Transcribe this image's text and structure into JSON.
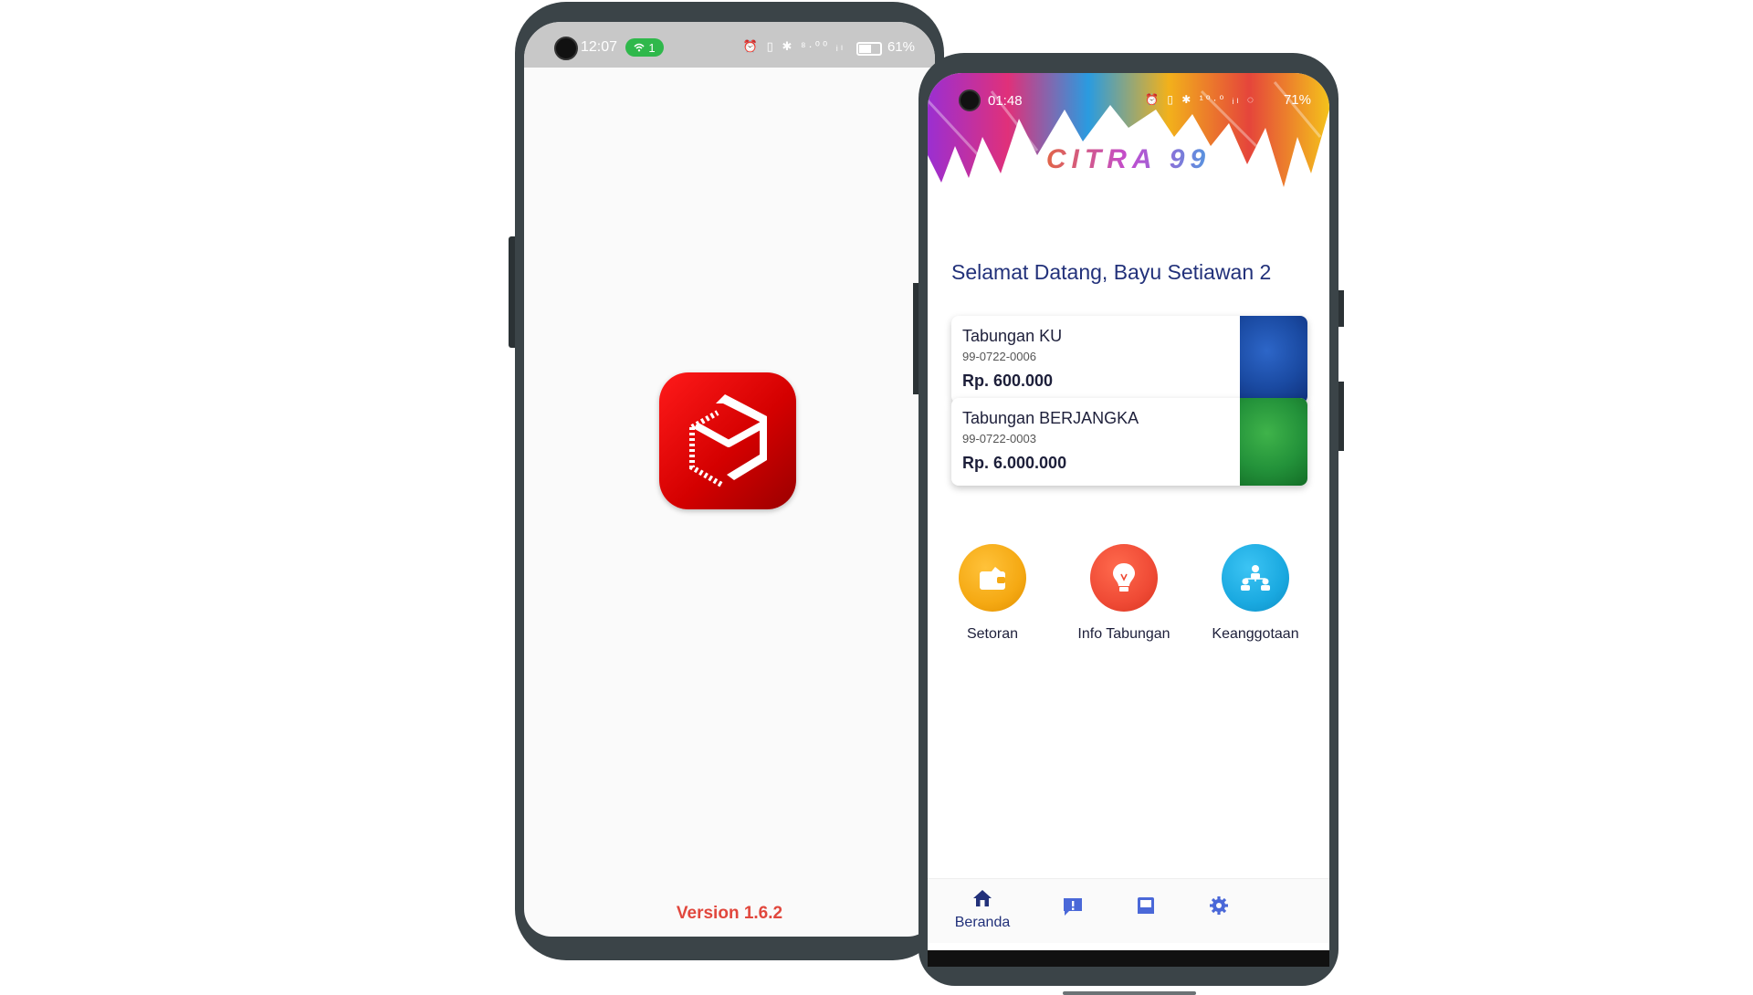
{
  "splash": {
    "status_bar": {
      "time": "12:07",
      "hotspot_count": "1",
      "icons": "⏰ ▯ ✱ ⁸·⁰⁰ ᵢₗ",
      "battery_pct": "61%"
    },
    "version": "Version 1.6.2",
    "logo_color": "#e00000"
  },
  "home": {
    "status_bar": {
      "time": "01:48",
      "icons": "⏰ ▯ ✱ ¹⁰·⁰ ᵢₗ ◌",
      "battery_pct": "71%"
    },
    "brand": "CITRA 99",
    "welcome": "Selamat Datang, Bayu Setiawan 2",
    "accounts": [
      {
        "name": "Tabungan KU",
        "number": "99-0722-0006",
        "balance": "Rp. 600.000",
        "color": "#1a4aa2"
      },
      {
        "name": "Tabungan BERJANGKA",
        "number": "99-0722-0003",
        "balance": "Rp. 6.000.000",
        "color": "#23923a"
      }
    ],
    "menu": [
      {
        "label": "Setoran",
        "icon": "wallet-icon",
        "color": "#f5a913"
      },
      {
        "label": "Info Tabungan",
        "icon": "lightbulb-icon",
        "color": "#ef4a35"
      },
      {
        "label": "Keanggotaan",
        "icon": "members-icon",
        "color": "#1aa9e0"
      }
    ],
    "bottom_nav": [
      {
        "label": "Beranda",
        "icon": "home-icon"
      },
      {
        "label": "",
        "icon": "alert-message-icon"
      },
      {
        "label": "",
        "icon": "inbox-icon"
      },
      {
        "label": "",
        "icon": "gear-icon"
      }
    ],
    "nav_active_color": "#22317a",
    "nav_inactive_color": "#4a68d8"
  }
}
